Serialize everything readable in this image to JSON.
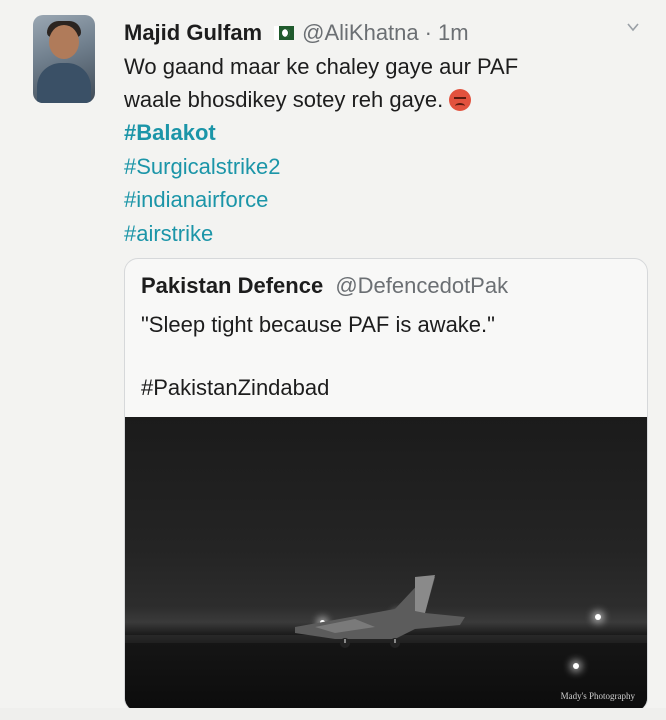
{
  "tweet": {
    "display_name": "Majid Gulfam",
    "handle": "@AliKhatna",
    "separator": "·",
    "time": "1m",
    "text_line1": "Wo gaand maar ke chaley gaye aur PAF",
    "text_line2": "waale bhosdikey sotey reh gaye.",
    "hashtags": [
      "#Balakot",
      "#Surgicalstrike2",
      "#indianairforce",
      "#airstrike"
    ],
    "flag_icon": "pakistan-flag-icon",
    "emoji_icon": "angry-face-icon",
    "menu_icon": "chevron-down-icon"
  },
  "quoted": {
    "display_name": "Pakistan Defence",
    "handle": "@DefencedotPak",
    "text": "\"Sleep tight because PAF is awake.\"",
    "hashtag": "#PakistanZindabad",
    "photo_watermark": "Mady's Photography"
  },
  "colors": {
    "hashtag": "#1b95a8",
    "muted": "#6b6f73",
    "text": "#1d1d1d"
  }
}
